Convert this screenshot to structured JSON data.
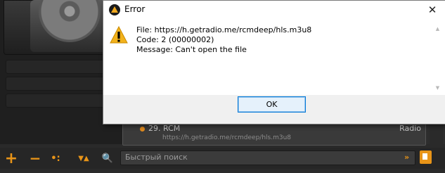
{
  "dialog": {
    "title": "Error",
    "close_glyph": "✕",
    "lines": {
      "file": "File: https://h.getradio.me/rcmdeep/hls.m3u8",
      "code": "Code: 2 (00000002)",
      "message": "Message: Can't open the file"
    },
    "ok_label": "OK",
    "icon": "warning-icon"
  },
  "playlist": {
    "row": {
      "title": "29. RCM",
      "url": "https://h.getradio.me/rcmdeep/hls.m3u8",
      "genre": "Radio"
    }
  },
  "toolbar": {
    "add_glyph": "+",
    "remove_glyph": "−",
    "misc_glyph": "•:",
    "sort_glyph": "▼▲",
    "search_glyph": "🔍",
    "search_placeholder": "Быстрый поиск",
    "search_go_glyph": "»"
  },
  "colors": {
    "accent": "#e89418",
    "dialog_bg": "#f0f0f0",
    "ok_border": "#0078d7"
  }
}
